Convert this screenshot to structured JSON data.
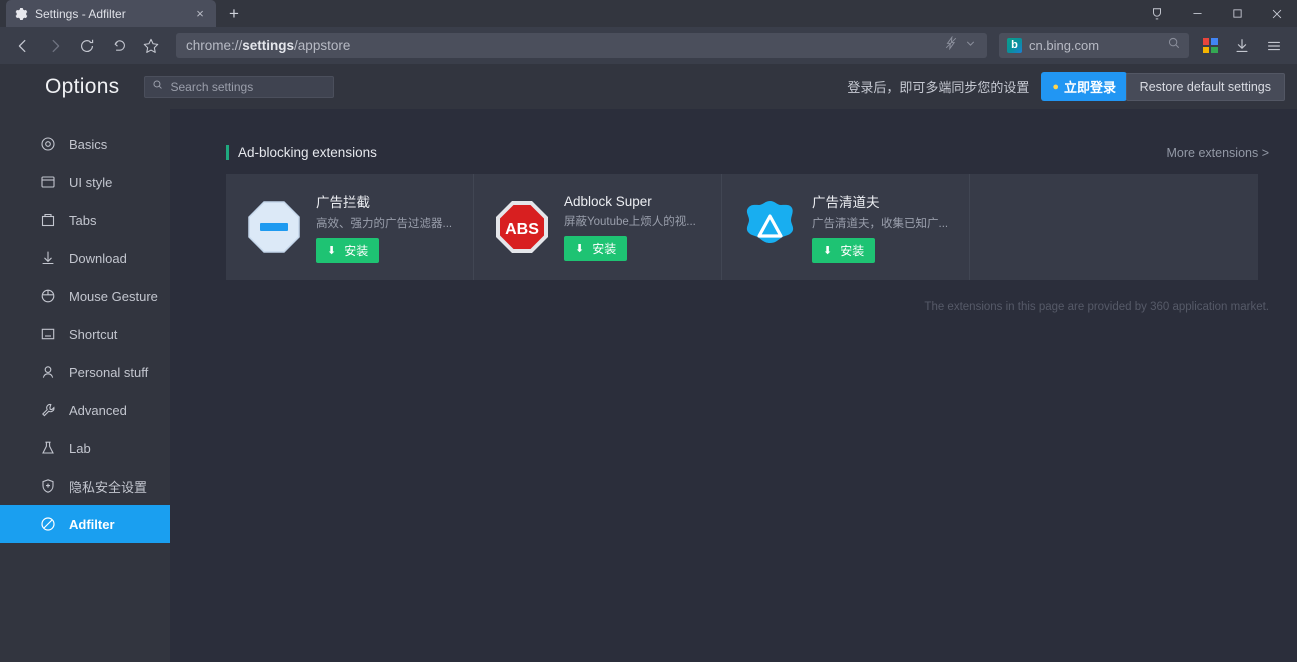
{
  "window": {
    "tab": {
      "title": "Settings - Adfilter",
      "favicon": "gear-icon",
      "close": "×"
    },
    "new_tab": "+",
    "controls": {
      "minimize": "—",
      "maximize": "❐",
      "close": "✕"
    }
  },
  "navbar": {
    "back": "‹",
    "forward": "›",
    "reload": "↻",
    "history": "↺",
    "bookmark": "☆",
    "url_prefix": "chrome://",
    "url_bold": "settings",
    "url_suffix": "/appstore",
    "url_full": "chrome://settings/appstore",
    "lightning_icon": "lightning-slash-icon",
    "chevron_icon": "chevron-down-icon",
    "search_engine": "cn.bing.com",
    "search_engine_badge": "b",
    "search_icon": "search-icon",
    "apps_icon": "apps-grid-icon",
    "download_icon": "download-icon",
    "menu_icon": "hamburger-menu-icon"
  },
  "header": {
    "title": "Options",
    "search_placeholder": "Search settings",
    "login_text": "登录后，即可多端同步您的设置",
    "login_button": "立即登录",
    "restore_button": "Restore default settings"
  },
  "sidebar": {
    "items": [
      {
        "label": "Basics",
        "icon": "target-icon",
        "active": false
      },
      {
        "label": "UI style",
        "icon": "window-icon",
        "active": false
      },
      {
        "label": "Tabs",
        "icon": "tabs-icon",
        "active": false
      },
      {
        "label": "Download",
        "icon": "download-arrow-icon",
        "active": false
      },
      {
        "label": "Mouse Gesture",
        "icon": "mouse-icon",
        "active": false
      },
      {
        "label": "Shortcut",
        "icon": "keyboard-icon",
        "active": false
      },
      {
        "label": "Personal stuff",
        "icon": "person-icon",
        "active": false
      },
      {
        "label": "Advanced",
        "icon": "wrench-icon",
        "active": false
      },
      {
        "label": "Lab",
        "icon": "flask-icon",
        "active": false
      },
      {
        "label": "隐私安全设置",
        "icon": "shield-plus-icon",
        "active": false
      },
      {
        "label": "Adfilter",
        "icon": "block-circle-icon",
        "active": true
      }
    ]
  },
  "main": {
    "section_title": "Ad-blocking extensions",
    "more_link": "More extensions >",
    "accent_color": "#1fa97f",
    "install_label": "安装",
    "install_color": "#1ec373",
    "extensions": [
      {
        "name": "广告拦截",
        "desc": "高效、强力的广告过滤器...",
        "icon": "octagon-minus-icon",
        "install": "安装"
      },
      {
        "name": "Adblock Super",
        "desc": "屏蔽Youtube上烦人的视...",
        "icon": "abs-octagon-icon",
        "install": "安装"
      },
      {
        "name": "广告清道夫",
        "desc": "广告清道夫，收集已知广...",
        "icon": "blue-triangle-icon",
        "install": "安装"
      }
    ],
    "footnote": "The extensions in this page are provided by 360 application market."
  }
}
